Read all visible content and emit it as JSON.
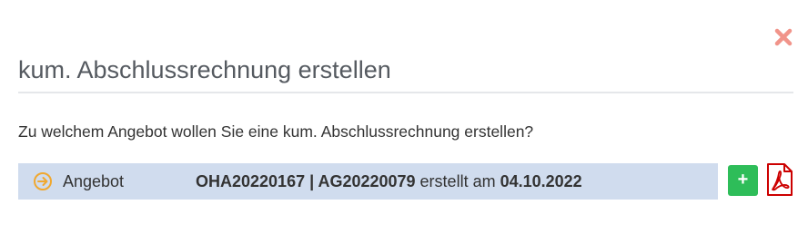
{
  "dialog": {
    "title": "kum. Abschlussrechnung erstellen",
    "question": "Zu welchem Angebot wollen Sie eine kum. Abschlussrechnung erstellen?",
    "close_icon": "close-icon"
  },
  "offer": {
    "icon": "arrow-circle-right-icon",
    "label": "Angebot",
    "offer_number": "OHA20220167 | AG20220079",
    "created_text": " erstellt am ",
    "created_date": "04.10.2022"
  },
  "actions": {
    "add_label": "+",
    "add_icon": "plus-icon",
    "pdf_icon": "pdf-icon"
  },
  "colors": {
    "row_background": "#d0dcee",
    "arrow_icon": "#f0a830",
    "add_button": "#2ebd59",
    "pdf_icon": "#cc0000",
    "close_icon": "#f1948a"
  }
}
